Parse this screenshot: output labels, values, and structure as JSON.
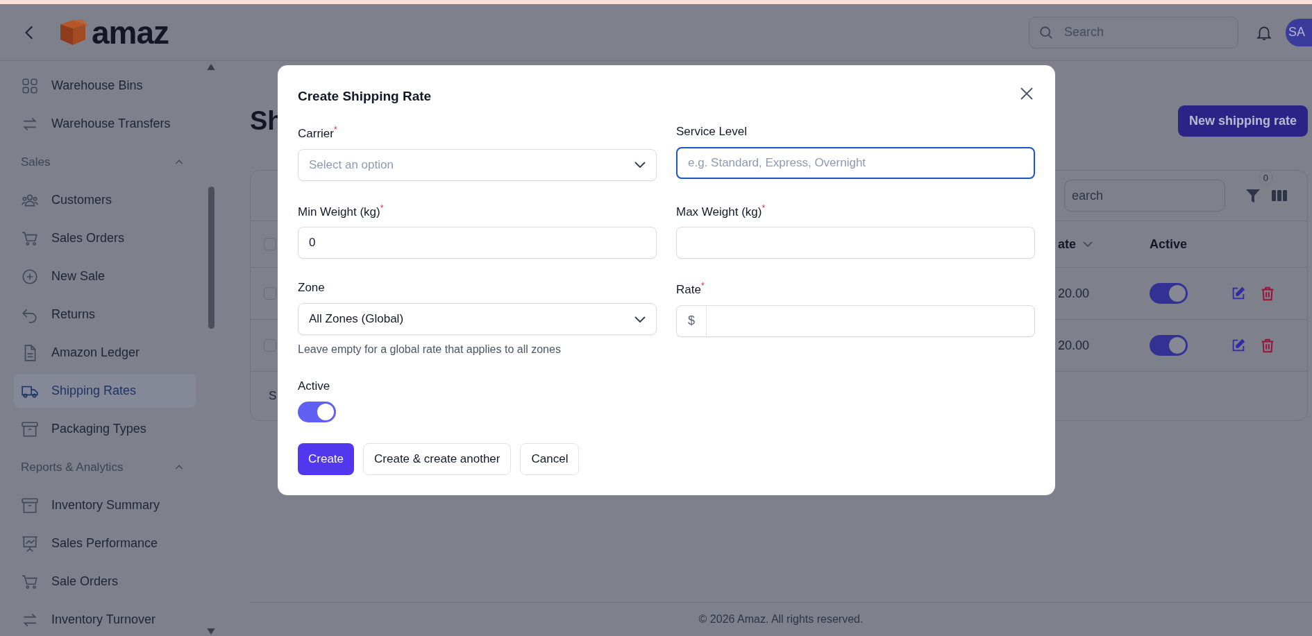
{
  "header": {
    "logo_text": "amaz",
    "search": {
      "placeholder": "Search"
    },
    "avatar": "SA"
  },
  "sidebar": {
    "groups": [
      {
        "items": [
          {
            "label": "Warehouse Bins",
            "selected": false
          },
          {
            "label": "Warehouse Transfers",
            "selected": false
          }
        ]
      },
      {
        "title": "Sales",
        "expanded": true,
        "items": [
          {
            "label": "Customers",
            "selected": false
          },
          {
            "label": "Sales Orders",
            "selected": false
          },
          {
            "label": "New Sale",
            "selected": false
          },
          {
            "label": "Returns",
            "selected": false
          },
          {
            "label": "Amazon Ledger",
            "selected": false
          },
          {
            "label": "Shipping Rates",
            "selected": true
          },
          {
            "label": "Packaging Types",
            "selected": false
          }
        ]
      },
      {
        "title": "Reports & Analytics",
        "expanded": true,
        "items": [
          {
            "label": "Inventory Summary",
            "selected": false
          },
          {
            "label": "Sales Performance",
            "selected": false
          },
          {
            "label": "Sale Orders",
            "selected": false
          },
          {
            "label": "Inventory Turnover",
            "selected": false
          }
        ]
      }
    ]
  },
  "page": {
    "title": "Sh",
    "new_button": "New shipping rate",
    "table": {
      "search": {
        "placeholder": "earch"
      },
      "filter_count": "0",
      "select_all_checked": false,
      "columns": [
        {
          "label": "ate",
          "sortable": true
        },
        {
          "label": "Active",
          "sortable": false
        }
      ],
      "rows": [
        {
          "checked": false,
          "rate": "20.00",
          "active": true
        },
        {
          "checked": false,
          "rate": "20.00",
          "active": true
        }
      ],
      "footer": "S"
    }
  },
  "footer": "© 2026 Amaz. All rights reserved.",
  "dialog": {
    "title": "Create Shipping Rate",
    "fields": [
      {
        "kind": "select",
        "label": "Carrier$^{*}$",
        "placeholder": "Select an option",
        "focused": false
      },
      {
        "kind": "text",
        "label": "Service Level",
        "placeholder": "e.g. Standard, Express, Overnight",
        "focused": true
      },
      {
        "kind": "text",
        "label": "Min Weight (kg)$^{*}$",
        "value": "0",
        "focused": false
      },
      {
        "kind": "text",
        "label": "Max Weight (kg)$^{*}$",
        "focused": false
      },
      {
        "kind": "select",
        "label": "Zone",
        "value": "All Zones (Global)",
        "help": "Leave empty for a global rate that applies to all zones",
        "focused": false
      },
      {
        "kind": "currency",
        "label": "Rate$^{*}$",
        "prefix": "$",
        "focused": false
      }
    ],
    "active": {
      "label": "Active",
      "on": true
    },
    "buttons": [
      {
        "label": "Create",
        "kind": "primary"
      },
      {
        "label": "Create & create another",
        "kind": "secondary"
      },
      {
        "label": "Cancel",
        "kind": "secondary"
      }
    ]
  }
}
